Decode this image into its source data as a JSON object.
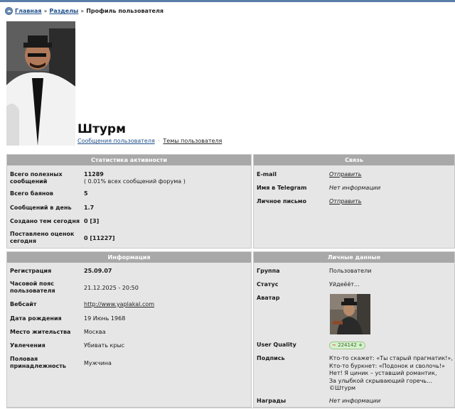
{
  "breadcrumb": {
    "home": "Главная",
    "sep1": "»",
    "sections": "Разделы",
    "sep2": "»",
    "current": "Профиль пользователя"
  },
  "profile": {
    "username": "Штурм",
    "posts_link": "Сообщения пользователя",
    "separator": "·",
    "topics_link": "Темы пользователя"
  },
  "stats": {
    "title": "Статистика активности",
    "rows": [
      {
        "label": "Всего полезных сообщений",
        "value": "11289",
        "sub": "( 0.01% всех сообщений форума )"
      },
      {
        "label": "Всего баянов",
        "value": "5"
      },
      {
        "label": "Сообщений в день",
        "value": "1.7"
      },
      {
        "label": "Создано тем сегодня",
        "value": "0 [3]"
      },
      {
        "label": "Поставлено оценок сегодня",
        "value": "0 [11227]"
      }
    ]
  },
  "contact": {
    "title": "Связь",
    "rows": [
      {
        "label": "E-mail",
        "value": "Отправить"
      },
      {
        "label": "Имя в Telegram",
        "value": "Нет информации"
      },
      {
        "label": "Личное письмо",
        "value": "Отправить"
      }
    ]
  },
  "info": {
    "title": "Информация",
    "rows": [
      {
        "label": "Регистрация",
        "value": "25.09.07"
      },
      {
        "label": "Часовой пояс пользователя",
        "value": "21.12.2025 - 20:50"
      },
      {
        "label": "Вебсайт",
        "value": "http://www.yaplakal.com"
      },
      {
        "label": "Дата рождения",
        "value": "19 Июнь 1968"
      },
      {
        "label": "Место жительства",
        "value": "Москва"
      },
      {
        "label": "Увлечения",
        "value": "Убивать крыс"
      },
      {
        "label": "Половая принадлежность",
        "value": "Мужчина"
      }
    ]
  },
  "personal": {
    "title": "Личные данные",
    "group_label": "Группа",
    "group_value": "Пользователи",
    "status_label": "Статус",
    "status_value": "Уйдеёёт...",
    "avatar_label": "Аватар",
    "quality_label": "User Quality",
    "quality_minus": "−",
    "quality_value": "224142",
    "quality_plus": "+",
    "signature_label": "Подпись",
    "signature_lines": [
      "Кто-то скажет: «Ты старый прагматик!»,",
      "Кто-то буркнет: «Подонок и сволочь!»",
      "Нет! Я циник – уставший романтик,",
      "За улыбкой скрывающий горечь...",
      "©Штурм"
    ],
    "awards_label": "Награды",
    "awards_value": "Нет информации"
  },
  "icons": {
    "home": "home-icon"
  },
  "colors": {
    "header_bg": "#a8a8a8",
    "panel_bg": "#e6e6e6",
    "link": "#1e4f8a",
    "topbar": "#5b7ea8"
  }
}
